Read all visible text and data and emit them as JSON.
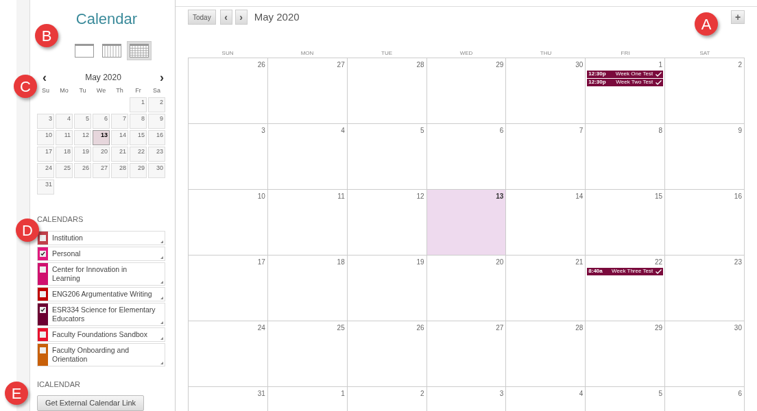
{
  "sidebar": {
    "title": "Calendar",
    "views": [
      {
        "kind": "day",
        "selected": false
      },
      {
        "kind": "week",
        "selected": false
      },
      {
        "kind": "month",
        "selected": true
      }
    ],
    "mini_calendar": {
      "prev": "‹",
      "month": "May 2020",
      "next": "›",
      "weekdays": [
        "Su",
        "Mo",
        "Tu",
        "We",
        "Th",
        "Fr",
        "Sa"
      ],
      "weeks": [
        [
          {
            "day": "1",
            "selected": false
          },
          {
            "day": "2",
            "selected": false
          }
        ],
        [
          {
            "day": "3",
            "selected": false
          },
          {
            "day": "4",
            "selected": false
          },
          {
            "day": "5",
            "selected": false
          },
          {
            "day": "6",
            "selected": false
          },
          {
            "day": "7",
            "selected": false
          },
          {
            "day": "8",
            "selected": false
          },
          {
            "day": "9",
            "selected": false
          }
        ],
        [
          {
            "day": "10",
            "selected": false
          },
          {
            "day": "11",
            "selected": false
          },
          {
            "day": "12",
            "selected": false
          },
          {
            "day": "13",
            "selected": true
          },
          {
            "day": "14",
            "selected": false
          },
          {
            "day": "15",
            "selected": false
          },
          {
            "day": "16",
            "selected": false
          }
        ],
        [
          {
            "day": "17",
            "selected": false
          },
          {
            "day": "18",
            "selected": false
          },
          {
            "day": "19",
            "selected": false
          },
          {
            "day": "20",
            "selected": false
          },
          {
            "day": "21",
            "selected": false
          },
          {
            "day": "22",
            "selected": false
          },
          {
            "day": "23",
            "selected": false
          }
        ],
        [
          {
            "day": "24",
            "selected": false
          },
          {
            "day": "25",
            "selected": false
          },
          {
            "day": "26",
            "selected": false
          },
          {
            "day": "27",
            "selected": false
          },
          {
            "day": "28",
            "selected": false
          },
          {
            "day": "29",
            "selected": false
          },
          {
            "day": "30",
            "selected": false
          }
        ],
        [
          {
            "day": "31",
            "selected": false
          }
        ]
      ]
    },
    "calendars_heading": "CALENDARS",
    "calendars": [
      {
        "name": "Institution",
        "checked": false,
        "color": "#c0404a"
      },
      {
        "name": "Personal",
        "checked": true,
        "color": "#e0197d"
      },
      {
        "name": "Center for Innovation in Learning",
        "checked": false,
        "color": "#d0106e"
      },
      {
        "name": "ENG206 Argumentative Writing",
        "checked": false,
        "color": "#c00000"
      },
      {
        "name": "ESR334 Science for Elementary Educators",
        "checked": true,
        "color": "#6b0032"
      },
      {
        "name": "Faculty Foundations Sandbox",
        "checked": false,
        "color": "#e8112d"
      },
      {
        "name": "Faculty Onboarding and Orientation",
        "checked": false,
        "color": "#c8600a"
      }
    ],
    "icalendar_heading": "ICALENDAR",
    "link_button": "Get External Calendar Link"
  },
  "toolbar": {
    "today": "Today",
    "prev": "‹",
    "next": "›",
    "month": "May 2020",
    "add": "+"
  },
  "weekdays": [
    "SUN",
    "MON",
    "TUE",
    "WED",
    "THU",
    "FRI",
    "SAT"
  ],
  "weeks": [
    [
      {
        "day": "26",
        "selected": false
      },
      {
        "day": "27",
        "selected": false
      },
      {
        "day": "28",
        "selected": false
      },
      {
        "day": "29",
        "selected": false
      },
      {
        "day": "30",
        "selected": false
      },
      {
        "day": "1",
        "selected": false,
        "events": [
          {
            "time": "12:30p",
            "title": "Week One Test"
          },
          {
            "time": "12:30p",
            "title": "Week Two Test"
          }
        ]
      },
      {
        "day": "2",
        "selected": false
      }
    ],
    [
      {
        "day": "3",
        "selected": false
      },
      {
        "day": "4",
        "selected": false
      },
      {
        "day": "5",
        "selected": false
      },
      {
        "day": "6",
        "selected": false
      },
      {
        "day": "7",
        "selected": false
      },
      {
        "day": "8",
        "selected": false
      },
      {
        "day": "9",
        "selected": false
      }
    ],
    [
      {
        "day": "10",
        "selected": false
      },
      {
        "day": "11",
        "selected": false
      },
      {
        "day": "12",
        "selected": false
      },
      {
        "day": "13",
        "selected": true
      },
      {
        "day": "14",
        "selected": false
      },
      {
        "day": "15",
        "selected": false
      },
      {
        "day": "16",
        "selected": false
      }
    ],
    [
      {
        "day": "17",
        "selected": false
      },
      {
        "day": "18",
        "selected": false
      },
      {
        "day": "19",
        "selected": false
      },
      {
        "day": "20",
        "selected": false
      },
      {
        "day": "21",
        "selected": false
      },
      {
        "day": "22",
        "selected": false,
        "events": [
          {
            "time": "8:40a",
            "title": "Week Three Test"
          }
        ]
      },
      {
        "day": "23",
        "selected": false
      }
    ],
    [
      {
        "day": "24",
        "selected": false
      },
      {
        "day": "25",
        "selected": false
      },
      {
        "day": "26",
        "selected": false
      },
      {
        "day": "27",
        "selected": false
      },
      {
        "day": "28",
        "selected": false
      },
      {
        "day": "29",
        "selected": false
      },
      {
        "day": "30",
        "selected": false
      }
    ],
    [
      {
        "day": "31",
        "selected": false
      },
      {
        "day": "1",
        "selected": false
      },
      {
        "day": "2",
        "selected": false
      },
      {
        "day": "3",
        "selected": false
      },
      {
        "day": "4",
        "selected": false
      },
      {
        "day": "5",
        "selected": false
      },
      {
        "day": "6",
        "selected": false
      }
    ]
  ],
  "callouts": [
    {
      "letter": "A"
    },
    {
      "letter": "B"
    },
    {
      "letter": "C"
    },
    {
      "letter": "D"
    },
    {
      "letter": "E"
    }
  ]
}
